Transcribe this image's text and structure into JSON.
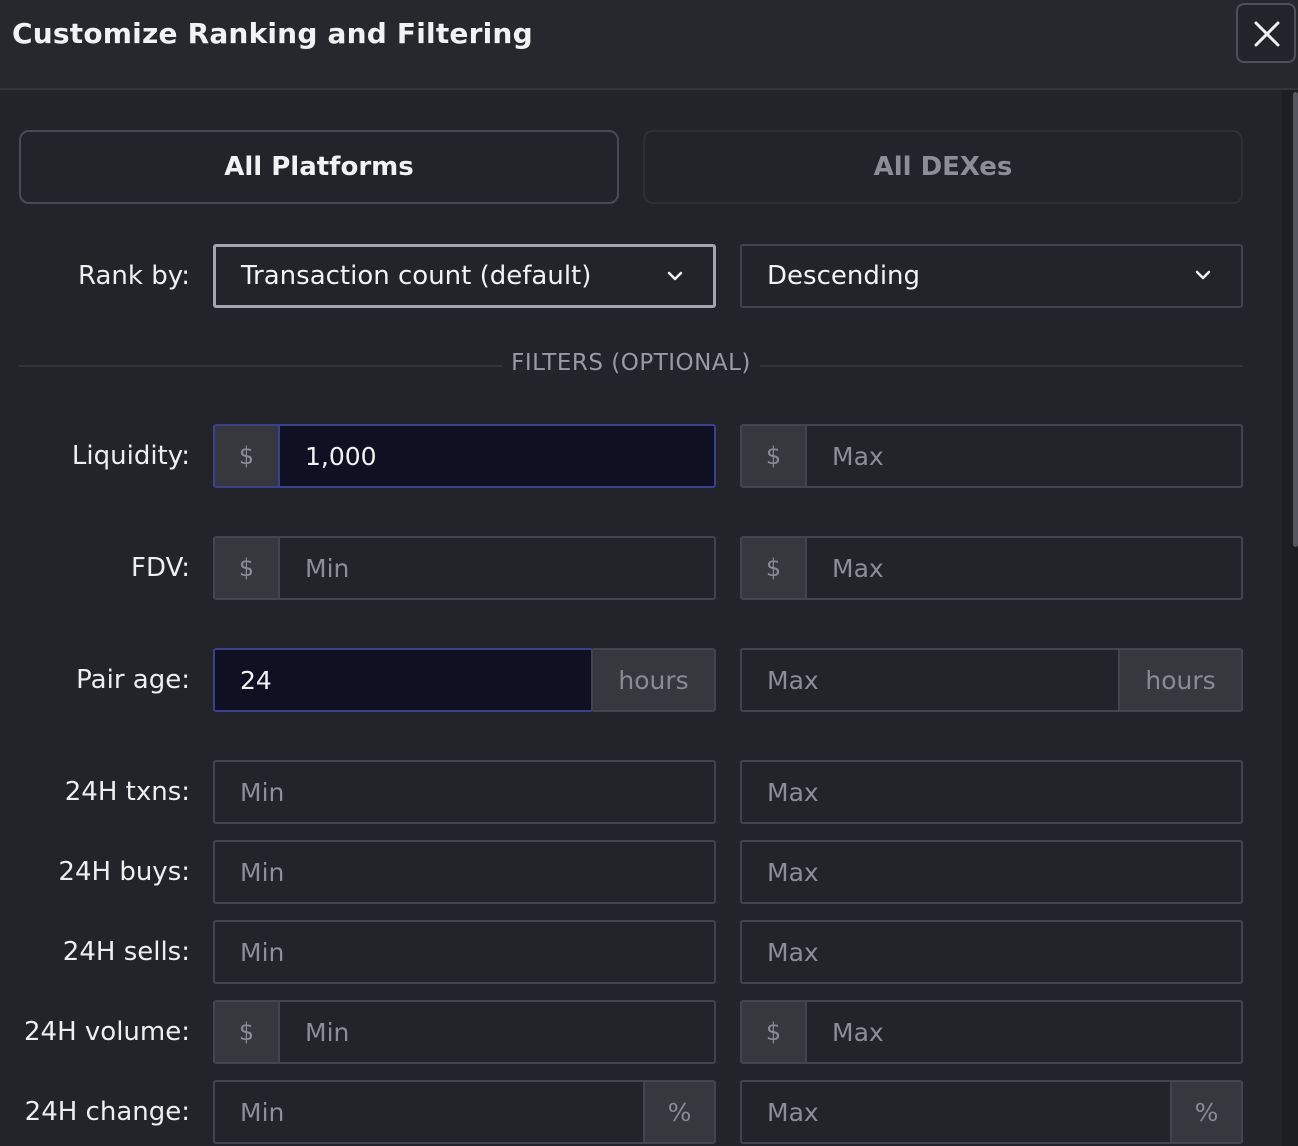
{
  "dialog": {
    "title": "Customize Ranking and Filtering"
  },
  "tabs": [
    {
      "label": "All Platforms",
      "active": true
    },
    {
      "label": "All DEXes",
      "active": false
    }
  ],
  "rank": {
    "label": "Rank by:",
    "field": "Transaction count (default)",
    "order": "Descending"
  },
  "filters_heading": "FILTERS (OPTIONAL)",
  "filters": {
    "liquidity": {
      "label": "Liquidity:",
      "prefix": "$",
      "min": "1,000",
      "max": "Max"
    },
    "fdv": {
      "label": "FDV:",
      "prefix": "$",
      "min": "Min",
      "max": "Max"
    },
    "pair_age": {
      "label": "Pair age:",
      "min": "24",
      "max": "Max",
      "unit": "hours"
    },
    "txns": {
      "label": "24H txns:",
      "min": "Min",
      "max": "Max"
    },
    "buys": {
      "label": "24H buys:",
      "min": "Min",
      "max": "Max"
    },
    "sells": {
      "label": "24H sells:",
      "min": "Min",
      "max": "Max"
    },
    "volume": {
      "label": "24H volume:",
      "prefix": "$",
      "min": "Min",
      "max": "Max"
    },
    "change": {
      "label": "24H change:",
      "min": "Min",
      "max": "Max",
      "unit": "%"
    }
  },
  "colors": {
    "focus_border": "#3b418f",
    "focus_bg": "#0f1122",
    "background": "#232429"
  }
}
